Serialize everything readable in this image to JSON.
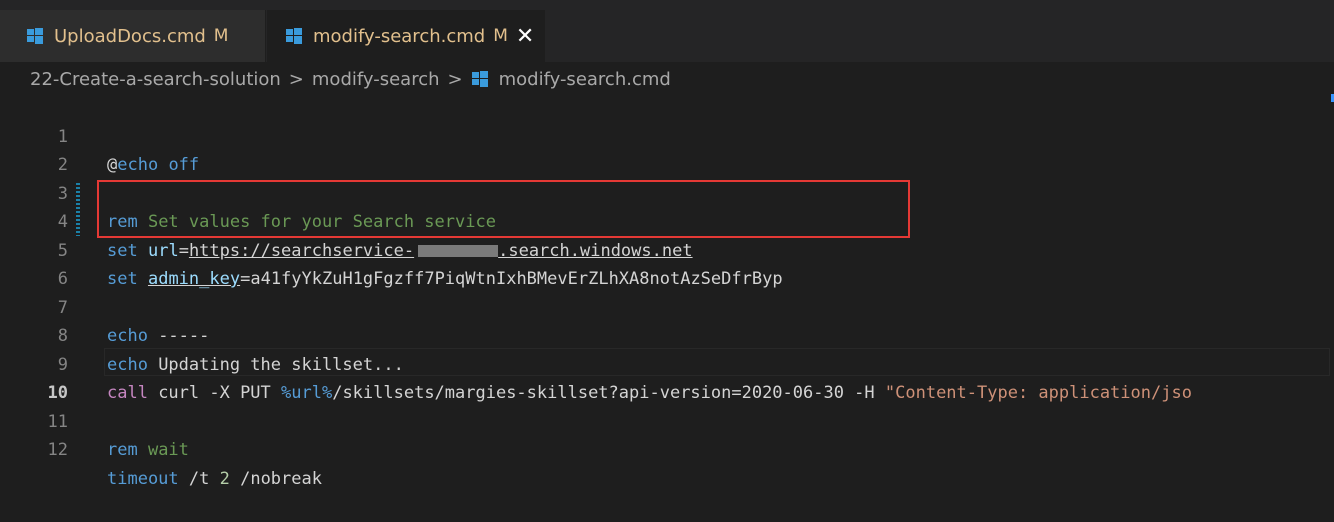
{
  "tabs": [
    {
      "name": "UploadDocs.cmd",
      "status": "M"
    },
    {
      "name": "modify-search.cmd",
      "status": "M",
      "close": "✕"
    }
  ],
  "breadcrumb": {
    "items": [
      "22-Create-a-search-solution",
      "modify-search",
      "modify-search.cmd"
    ],
    "separator": ">"
  },
  "editor": {
    "lines": [
      {
        "num": "1"
      },
      {
        "num": "2"
      },
      {
        "num": "3"
      },
      {
        "num": "4"
      },
      {
        "num": "5"
      },
      {
        "num": "6"
      },
      {
        "num": "7"
      },
      {
        "num": "8"
      },
      {
        "num": "9"
      },
      {
        "num": "10"
      },
      {
        "num": "11"
      },
      {
        "num": "12"
      }
    ],
    "l1": {
      "at": "@",
      "kw": "echo",
      "rest": " off"
    },
    "l3": {
      "kw": "rem",
      "comment": " Set values for your Search service"
    },
    "l4": {
      "kw": "set",
      "var": "url",
      "eq": "=",
      "val1": "https://searchservice-",
      "val2": ".search.windows.net"
    },
    "l5": {
      "kw": "set",
      "var": "admin_key",
      "eq": "=",
      "val": "a41fyYkZuH1gFgzff7PiqWtnIxhBMevErZLhXA8notAzSeDfrByp"
    },
    "l7": {
      "kw": "echo",
      "rest": " -----"
    },
    "l8": {
      "kw": "echo",
      "rest": " Updating the skillset..."
    },
    "l9": {
      "kw": "call",
      "rest1": " curl -X PUT ",
      "var": "%url%",
      "rest2": "/skillsets/margies-skillset?api-version=2020-06-30 -H ",
      "str": "\"Content-Type: application/jso"
    },
    "l11": {
      "kw": "rem",
      "comment": " wait"
    },
    "l12": {
      "kw": "timeout",
      "rest1": " /t ",
      "num": "2",
      "rest2": " /nobreak"
    }
  },
  "colors": {
    "keyword": "#569cd6",
    "comment": "#6a9955",
    "variable": "#9cdcfe",
    "string": "#ce9178",
    "highlight": "#e53935",
    "modified": "#e2c08d"
  },
  "icons": {
    "file": "windows-file-icon",
    "close": "close-icon"
  }
}
